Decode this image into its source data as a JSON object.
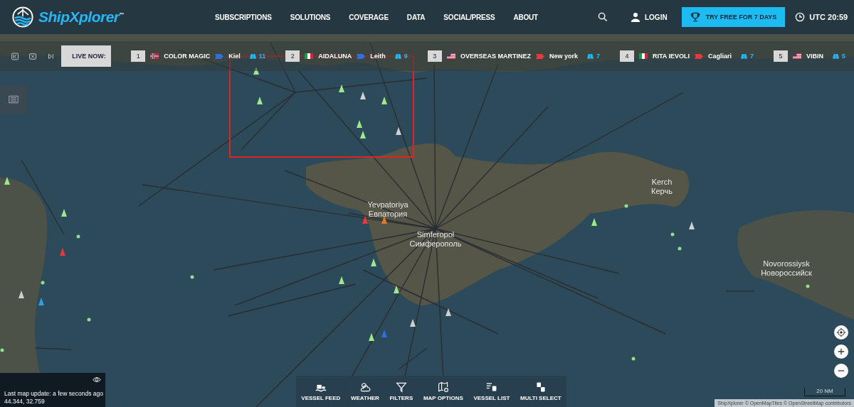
{
  "header": {
    "logo": "ShipXplorer",
    "logo_mark": "™",
    "nav": [
      "SUBSCRIPTIONS",
      "SOLUTIONS",
      "COVERAGE",
      "DATA",
      "SOCIAL/PRESS",
      "ABOUT"
    ],
    "login": "LOGIN",
    "cta": "TRY FREE FOR 7 DAYS",
    "clock": "UTC 20:59"
  },
  "live_bar": {
    "label": "LIVE NOW:",
    "vessels": [
      {
        "rank": "1",
        "kind": "norway",
        "name": "COLOR MAGIC",
        "destination": "Kiel",
        "color": "#2f6fe0",
        "viewers": "11"
      },
      {
        "rank": "2",
        "kind": "italy",
        "name": "AIDALUNA",
        "destination": "Leith",
        "color": "#2f6fe0",
        "viewers": "9"
      },
      {
        "rank": "3",
        "kind": "usa",
        "name": "OVERSEAS MARTINEZ",
        "destination": "New york",
        "color": "#e8383d",
        "viewers": "7"
      },
      {
        "rank": "4",
        "kind": "italy",
        "name": "RITA IEVOLI",
        "destination": "Cagliari",
        "color": "#e8383d",
        "viewers": "7"
      },
      {
        "rank": "5",
        "kind": "usa",
        "name": "VIBIN",
        "viewers": "5"
      }
    ]
  },
  "map": {
    "labels": [
      {
        "name": "Yevpatoriya",
        "native": "Евпатория"
      },
      {
        "name": "Simferopol",
        "native": "Симферополь"
      },
      {
        "name": "Kerch",
        "native": "Керчь"
      },
      {
        "name": "Novorossiysk",
        "native": "Новороссийск"
      }
    ]
  },
  "info": {
    "text": "Last map update: a few seconds ago",
    "coords": "44.344, 32.759"
  },
  "toolbar": [
    {
      "kind": "feed",
      "label": "VESSEL FEED"
    },
    {
      "kind": "weather",
      "label": "WEATHER"
    },
    {
      "kind": "filters",
      "label": "FILTERS"
    },
    {
      "kind": "map",
      "label": "MAP OPTIONS"
    },
    {
      "kind": "list",
      "label": "VESSEL LIST"
    },
    {
      "kind": "multi",
      "label": "MULTI SELECT"
    }
  ],
  "scale": "20 NM",
  "attribution": "ShipXplorer © OpenMapTiles © OpenStreetMap contributors"
}
